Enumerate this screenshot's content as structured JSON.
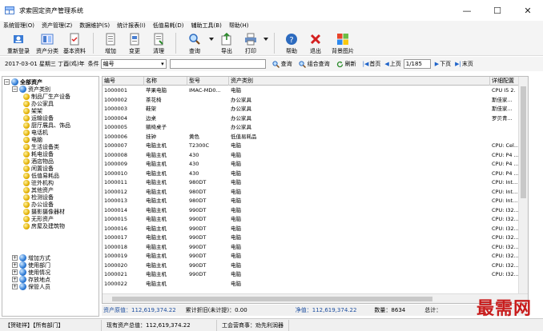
{
  "window": {
    "title": "求索固定资产管理系统",
    "min": "—",
    "max": "☐",
    "close": "✕"
  },
  "menu": [
    "系统管理(O)",
    "资产管理(Z)",
    "数据维护(S)",
    "统计报表(I)",
    "低值易耗(D)",
    "辅助工具(B)",
    "帮助(H)"
  ],
  "toolbar": {
    "relogin": "重新登录",
    "category": "资产分类",
    "basic": "基本资料",
    "add": "增加",
    "change": "变更",
    "clear": "清理",
    "query": "查询",
    "export": "导出",
    "print": "打印",
    "help": "帮助",
    "exit": "退出",
    "bgimage": "背景图片"
  },
  "filter": {
    "date": "2017-03-01 星期三 丁酉(鸡)年",
    "cond_label": "条件",
    "cond_value": "编号",
    "query": "查询",
    "combo_query": "组合查询",
    "refresh": "刷新",
    "first": "首页",
    "prev": "上页",
    "page": "1/185",
    "next": "下页",
    "last": "末页"
  },
  "tree": {
    "root": "全部资产",
    "category": "资产类别",
    "items": [
      "制品厂生产设备",
      "办公家具",
      "架架",
      "运输设备",
      "厨厅展具、饰品",
      "电话机",
      "电脑",
      "生活设备类",
      "耗电设备",
      "酒店物品",
      "闲置设备",
      "低值易耗品",
      "驻外机构",
      "其他资产",
      "检测设备",
      "办公设备",
      "摄影摄像器材",
      "无形资产",
      "房屋及建筑物"
    ],
    "groups": [
      "增加方式",
      "使用部门",
      "使用情况",
      "存放地点",
      "保管人员"
    ]
  },
  "grid": {
    "headers": [
      "编号",
      "名称",
      "型号",
      "资产类别",
      "详细配置"
    ],
    "rows": [
      [
        "1000001",
        "苹果电脑",
        "IMAC-MD0...",
        "电脑",
        "CPU I5 2."
      ],
      [
        "1000002",
        "茶花椅",
        "",
        "办公家具",
        "斯佳家..."
      ],
      [
        "1000003",
        "鞋架",
        "",
        "办公家具",
        "斯佳家..."
      ],
      [
        "1000004",
        "边桌",
        "",
        "办公家具",
        "罗贝青..."
      ],
      [
        "1000005",
        "躺椅桌子",
        "",
        "办公家具",
        ""
      ],
      [
        "1000006",
        "挂钟",
        "黄色",
        "低值易耗品",
        ""
      ],
      [
        "1000007",
        "电脑主机",
        "T2300C",
        "电脑",
        "CPU: Cel..."
      ],
      [
        "1000008",
        "电脑主机",
        "430",
        "电脑",
        "CPU: P4 ..."
      ],
      [
        "1000009",
        "电脑主机",
        "430",
        "电脑",
        "CPU: P4 ..."
      ],
      [
        "1000010",
        "电脑主机",
        "430",
        "电脑",
        "CPU: P4 ..."
      ],
      [
        "1000011",
        "电脑主机",
        "980DT",
        "电脑",
        "CPU: Int..."
      ],
      [
        "1000012",
        "电脑主机",
        "980DT",
        "电脑",
        "CPU: Int..."
      ],
      [
        "1000013",
        "电脑主机",
        "980DT",
        "电脑",
        "CPU: Int..."
      ],
      [
        "1000014",
        "电脑主机",
        "990DT",
        "电脑",
        "CPU: I32..."
      ],
      [
        "1000015",
        "电脑主机",
        "990DT",
        "电脑",
        "CPU: I32..."
      ],
      [
        "1000016",
        "电脑主机",
        "990DT",
        "电脑",
        "CPU: I32..."
      ],
      [
        "1000017",
        "电脑主机",
        "990DT",
        "电脑",
        "CPU: I32..."
      ],
      [
        "1000018",
        "电脑主机",
        "990DT",
        "电脑",
        "CPU: I32..."
      ],
      [
        "1000019",
        "电脑主机",
        "990DT",
        "电脑",
        "CPU: I32..."
      ],
      [
        "1000020",
        "电脑主机",
        "990DT",
        "电脑",
        "CPU: I32..."
      ],
      [
        "1000021",
        "电脑主机",
        "990DT",
        "电脑",
        "CPU: I32..."
      ],
      [
        "1000022",
        "电脑主机",
        "",
        "电脑",
        ""
      ]
    ]
  },
  "summary": {
    "orig": "资产原值：112,619,374.22",
    "depr": "累计折旧(未计提)：0.00",
    "net": "净值：112,619,374.22",
    "qty": "数量：8634",
    "total": "总计："
  },
  "status": {
    "user": "【贺硅祥】【所有部门】",
    "now": "现有资产总值：112,619,374.22",
    "company": "工会营商事：劝先利润器"
  },
  "watermark": "最需网",
  "colors": {
    "accent": "#1e63c9",
    "watermark": "#c81c1c"
  }
}
